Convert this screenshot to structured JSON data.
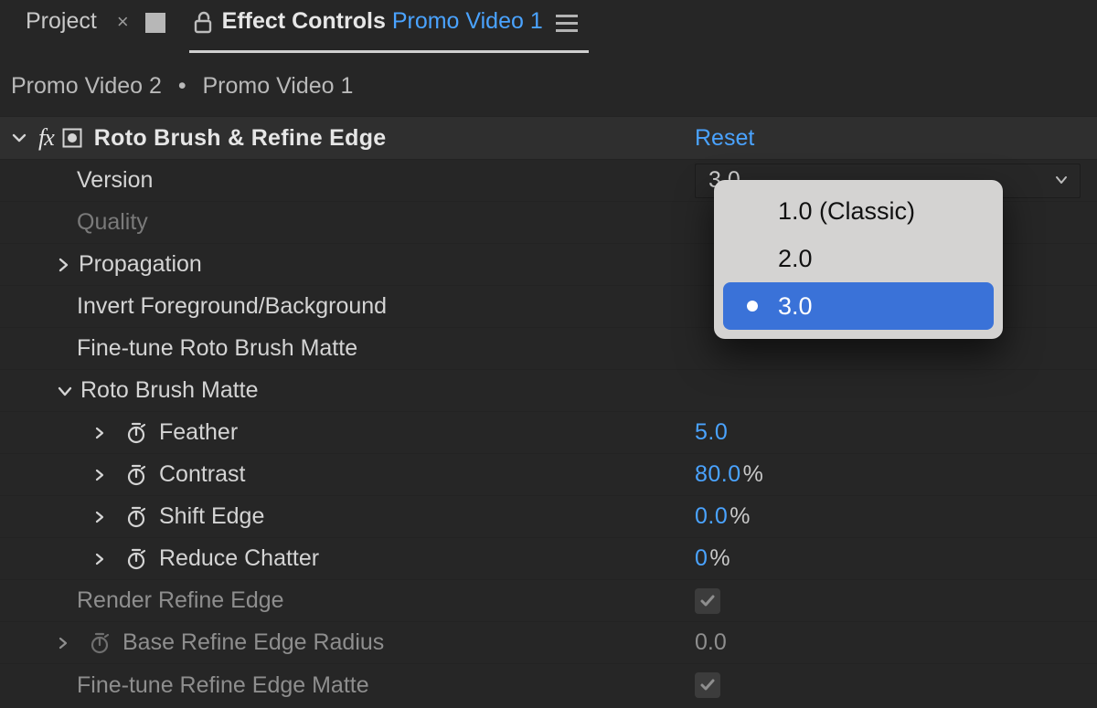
{
  "tabs": {
    "project": {
      "label": "Project"
    },
    "effect_controls": {
      "prefix": "Effect Controls",
      "title": "Promo Video 1"
    }
  },
  "breadcrumb": {
    "a": "Promo Video 2",
    "b": "Promo Video 1"
  },
  "effect": {
    "name": "Roto Brush & Refine Edge",
    "reset": "Reset",
    "version": {
      "label": "Version",
      "value": "3.0"
    },
    "quality": {
      "label": "Quality"
    },
    "propagation": {
      "label": "Propagation"
    },
    "invert_fg_bg": {
      "label": "Invert Foreground/Background"
    },
    "fine_tune_rb_matte": {
      "label": "Fine-tune Roto Brush Matte"
    },
    "rb_matte": {
      "label": "Roto Brush Matte",
      "feather": {
        "label": "Feather",
        "value": "5.0"
      },
      "contrast": {
        "label": "Contrast",
        "value": "80.0",
        "suffix": "%"
      },
      "shift_edge": {
        "label": "Shift Edge",
        "value": "0.0",
        "suffix": "%"
      },
      "reduce_chatter": {
        "label": "Reduce Chatter",
        "value": "0",
        "suffix": "%"
      }
    },
    "render_refine_edge": {
      "label": "Render Refine Edge",
      "checked": true
    },
    "base_refine_radius": {
      "label": "Base Refine Edge Radius",
      "value": "0.0"
    },
    "fine_tune_re_matte": {
      "label": "Fine-tune Refine Edge Matte",
      "checked": true
    }
  },
  "version_menu": {
    "options": [
      "1.0 (Classic)",
      "2.0",
      "3.0"
    ],
    "selected_index": 2
  }
}
